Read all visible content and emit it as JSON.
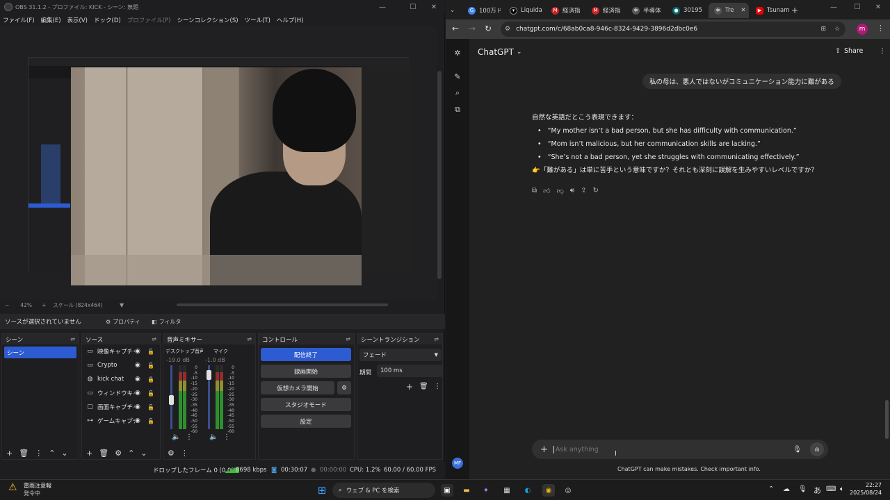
{
  "obs": {
    "title": "OBS 31.1.2 - プロファイル: KICK - シーン: 無題",
    "menu": [
      "ファイル(F)",
      "編集(E)",
      "表示(V)",
      "ドック(D)",
      "プロファイル(P)",
      "シーンコレクション(S)",
      "ツール(T)",
      "ヘルプ(H)"
    ],
    "zoom": "42%",
    "scale": "スケール (824x464)",
    "no_source": "ソースが選択されていません",
    "properties": "プロパティ",
    "filters": "フィルタ",
    "docks": {
      "scenes": "シーン",
      "sources": "ソース",
      "mixer": "音声ミキサー",
      "controls": "コントロール",
      "transitions": "シーントランジション"
    },
    "scene_items": [
      "シーン"
    ],
    "sources": [
      {
        "name": "映像キャプチャデバイス",
        "icon": "camera-icon"
      },
      {
        "name": "Crypto",
        "icon": "window-icon"
      },
      {
        "name": "kick chat",
        "icon": "browser-icon"
      },
      {
        "name": "ウィンドウキャプチャ",
        "icon": "window-icon"
      },
      {
        "name": "画面キャプチャ",
        "icon": "monitor-icon"
      },
      {
        "name": "ゲームキャプチャ",
        "icon": "gamepad-icon"
      }
    ],
    "mixer": [
      {
        "name": "デスクトップ音声",
        "db": "-19.0 dB"
      },
      {
        "name": "マイク",
        "db": "-1.0 dB"
      }
    ],
    "meter_scale": [
      "0",
      "-5",
      "-10",
      "-15",
      "-20",
      "-25",
      "-30",
      "-35",
      "-40",
      "-45",
      "-50",
      "-55",
      "-60"
    ],
    "controls": [
      "配信終了",
      "録画開始",
      "仮想カメラ開始",
      "スタジオモード",
      "設定"
    ],
    "transition": {
      "type": "フェード",
      "duration_label": "期間",
      "duration": "100 ms"
    },
    "status": {
      "dropped": "ドロップしたフレーム 0 (0.0%)",
      "bitrate": "8698 kbps",
      "stream_time": "00:30:07",
      "rec_time": "00:00:00",
      "cpu": "CPU: 1.2%",
      "fps": "60.00 / 60.00 FPS"
    }
  },
  "browser": {
    "tabs": [
      "100万ド",
      "Liquida",
      "経済指",
      "経済指",
      "半導体",
      "30195",
      "Tre",
      "Tsunam"
    ],
    "url": "chatgpt.com/c/68ab0ca8-946c-8324-9429-3896d2dbc0e6",
    "profile_initial": "m"
  },
  "chatgpt": {
    "model": "ChatGPT",
    "share": "Share",
    "user_message": "私の母は、悪人ではないがコミュニケーション能力に難がある",
    "answer_intro": "自然な英語だとこう表現できます：",
    "answer_items": [
      "“My mother isn’t a bad person, but she has difficulty with communication.”",
      "“Mom isn’t malicious, but her communication skills are lacking.”",
      "“She’s not a bad person, yet she struggles with communicating effectively.”"
    ],
    "followup": "👉「難がある」は単に苦手という意味ですか？それとも深刻に誤解を生みやすいレベルですか？",
    "placeholder": "Ask anything",
    "disclaimer": "ChatGPT can make mistakes. Check important info.",
    "user_avatar": "MF"
  },
  "taskbar": {
    "weather_title": "雷雨注意報",
    "weather_sub": "発令中",
    "search": "ウェブ & PC を検索",
    "ime": "あ",
    "time": "22:27",
    "date": "2025/08/24"
  }
}
